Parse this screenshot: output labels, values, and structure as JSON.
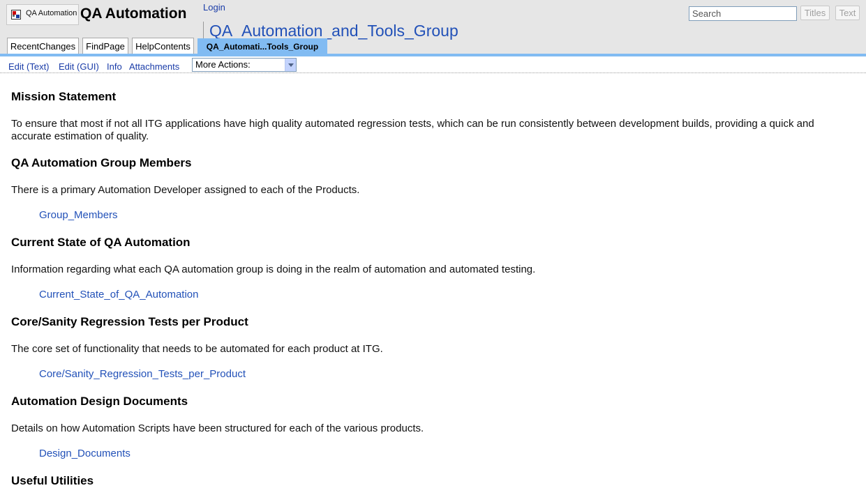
{
  "header": {
    "logo_text": "QA Automation",
    "site_name": "QA Automation",
    "login": "Login",
    "page_title": "QA_Automation_and_Tools_Group",
    "search": {
      "placeholder": "Search",
      "titles_button": "Titles",
      "text_button": "Text"
    }
  },
  "tabs": [
    {
      "label": "RecentChanges"
    },
    {
      "label": "FindPage"
    },
    {
      "label": "HelpContents"
    },
    {
      "label": "QA_Automati...Tools_Group",
      "current": true
    }
  ],
  "editbar": {
    "edit_text": "Edit (Text)",
    "edit_gui": "Edit (GUI)",
    "info": "Info",
    "attachments": "Attachments",
    "more_actions": "More Actions:"
  },
  "sections": [
    {
      "heading": "Mission Statement",
      "description": "To ensure that most if not all ITG applications have high quality automated regression tests, which can be run consistently between development builds, providing a quick and accurate estimation of quality."
    },
    {
      "heading": "QA Automation Group Members",
      "description": "There is a primary Automation Developer assigned to each of the Products.",
      "link": "Group_Members"
    },
    {
      "heading": "Current State of QA Automation",
      "description": "Information regarding what each QA automation group is doing in the realm of automation and automated testing.",
      "link": "Current_State_of_QA_Automation"
    },
    {
      "heading": "Core/Sanity Regression Tests per Product",
      "description": "The core set of functionality that needs to be automated for each product at ITG.",
      "link": "Core/Sanity_Regression_Tests_per_Product"
    },
    {
      "heading": "Automation Design Documents",
      "description": "Details on how Automation Scripts have been structured for each of the various products.",
      "link": "Design_Documents"
    },
    {
      "heading": "Useful Utilities"
    }
  ],
  "colors": {
    "accent": "#81bbf2",
    "link": "#2251b8",
    "header_bg": "#e6e6e6"
  }
}
